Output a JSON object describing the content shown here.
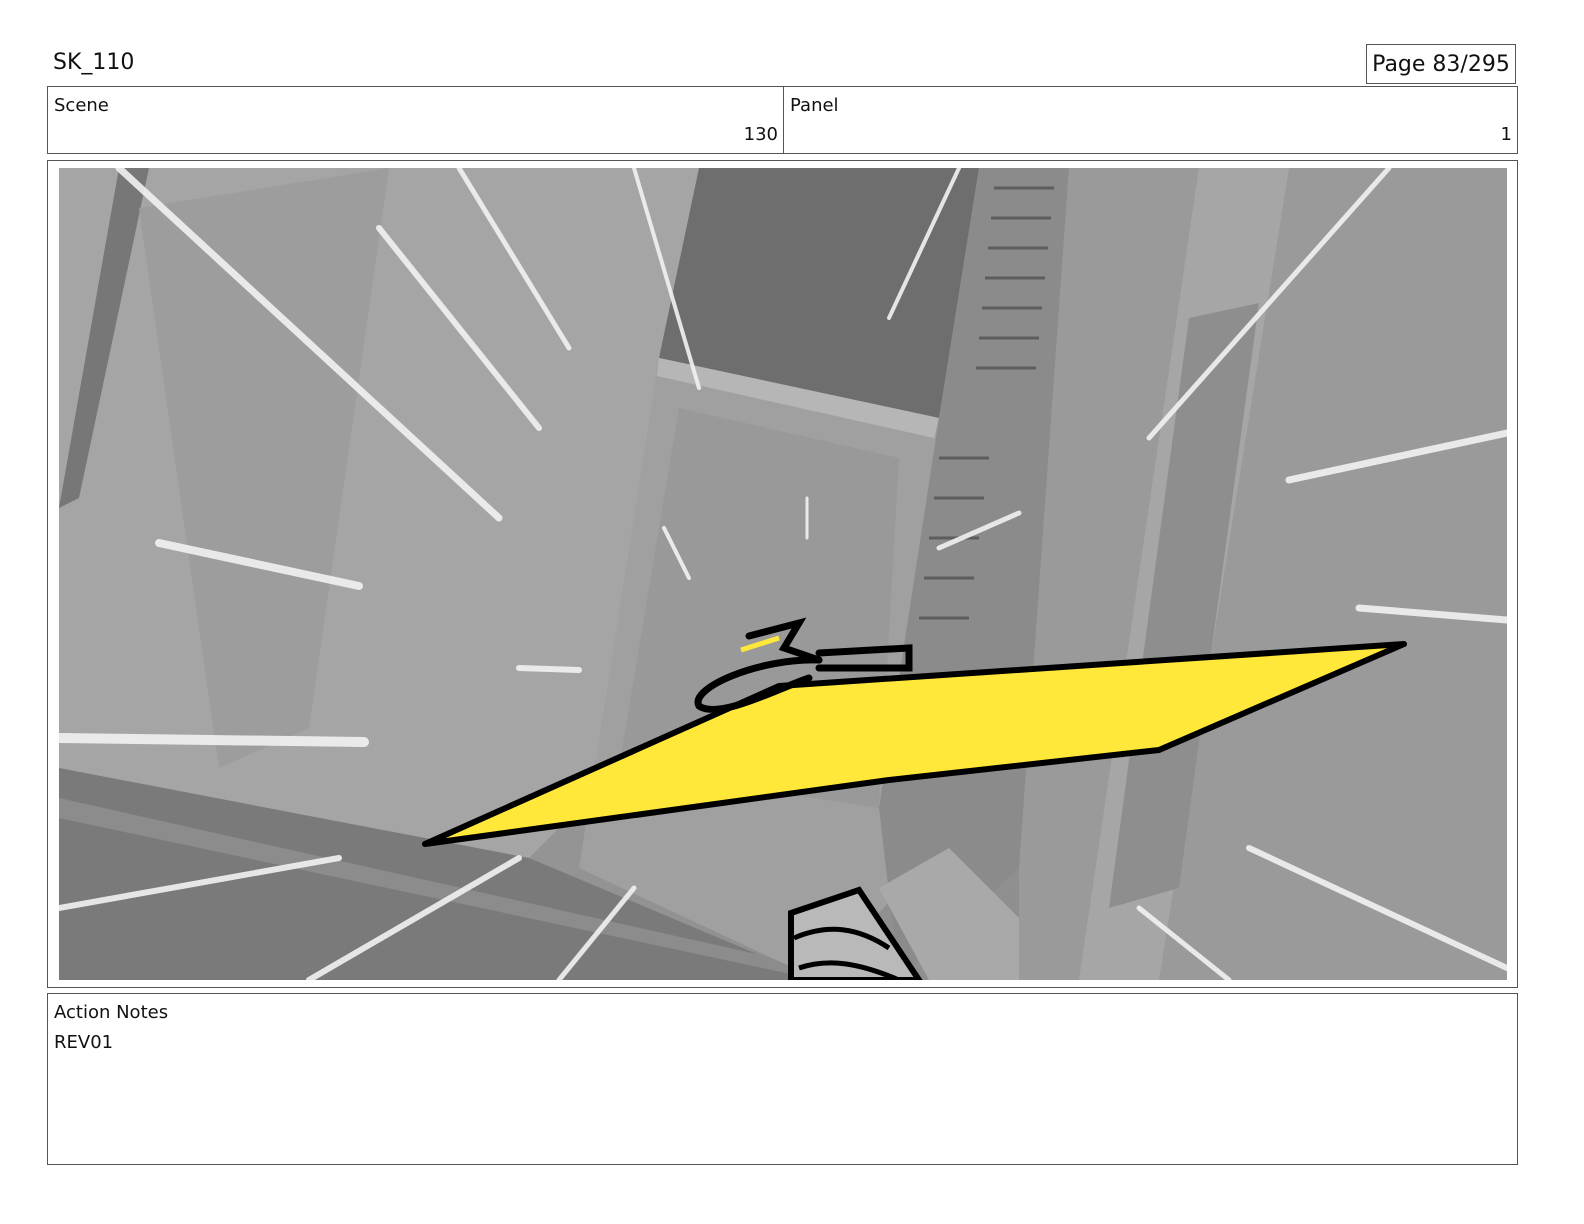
{
  "sheet": {
    "title": "SK_110",
    "page_label": "Page 83/295"
  },
  "info": {
    "scene_label": "Scene",
    "scene_value": "130",
    "panel_label": "Panel",
    "panel_value": "1"
  },
  "notes": {
    "label": "Action Notes",
    "text": "REV01"
  },
  "colors": {
    "board_yellow": "#ffe83a",
    "background_gray": "#8f8f8f",
    "ink": "#000000"
  }
}
